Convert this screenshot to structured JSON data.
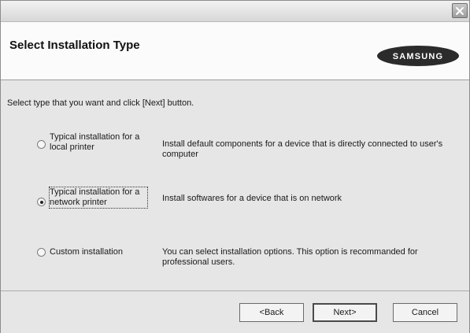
{
  "window": {
    "close_glyph": "✕"
  },
  "header": {
    "title": "Select Installation Type",
    "brand": "SAMSUNG"
  },
  "main": {
    "instruction": "Select type that you want and click [Next] button.",
    "options": [
      {
        "label_line1": "Typical installation for a",
        "label_line2": "local printer",
        "description_line1": "Install default components for a device that is directly connected to user's",
        "description_line2": "computer",
        "selected": false
      },
      {
        "label_line1": "Typical installation for a",
        "label_line2": "network printer",
        "description_line1": "Install softwares for a device that is on network",
        "description_line2": "",
        "selected": true
      },
      {
        "label_line1": "Custom installation",
        "label_line2": "",
        "description_line1": "You can select installation options. This option is recommanded for",
        "description_line2": "professional users.",
        "selected": false
      }
    ]
  },
  "footer": {
    "back_label": "<Back",
    "next_label": "Next>",
    "cancel_label": "Cancel"
  }
}
